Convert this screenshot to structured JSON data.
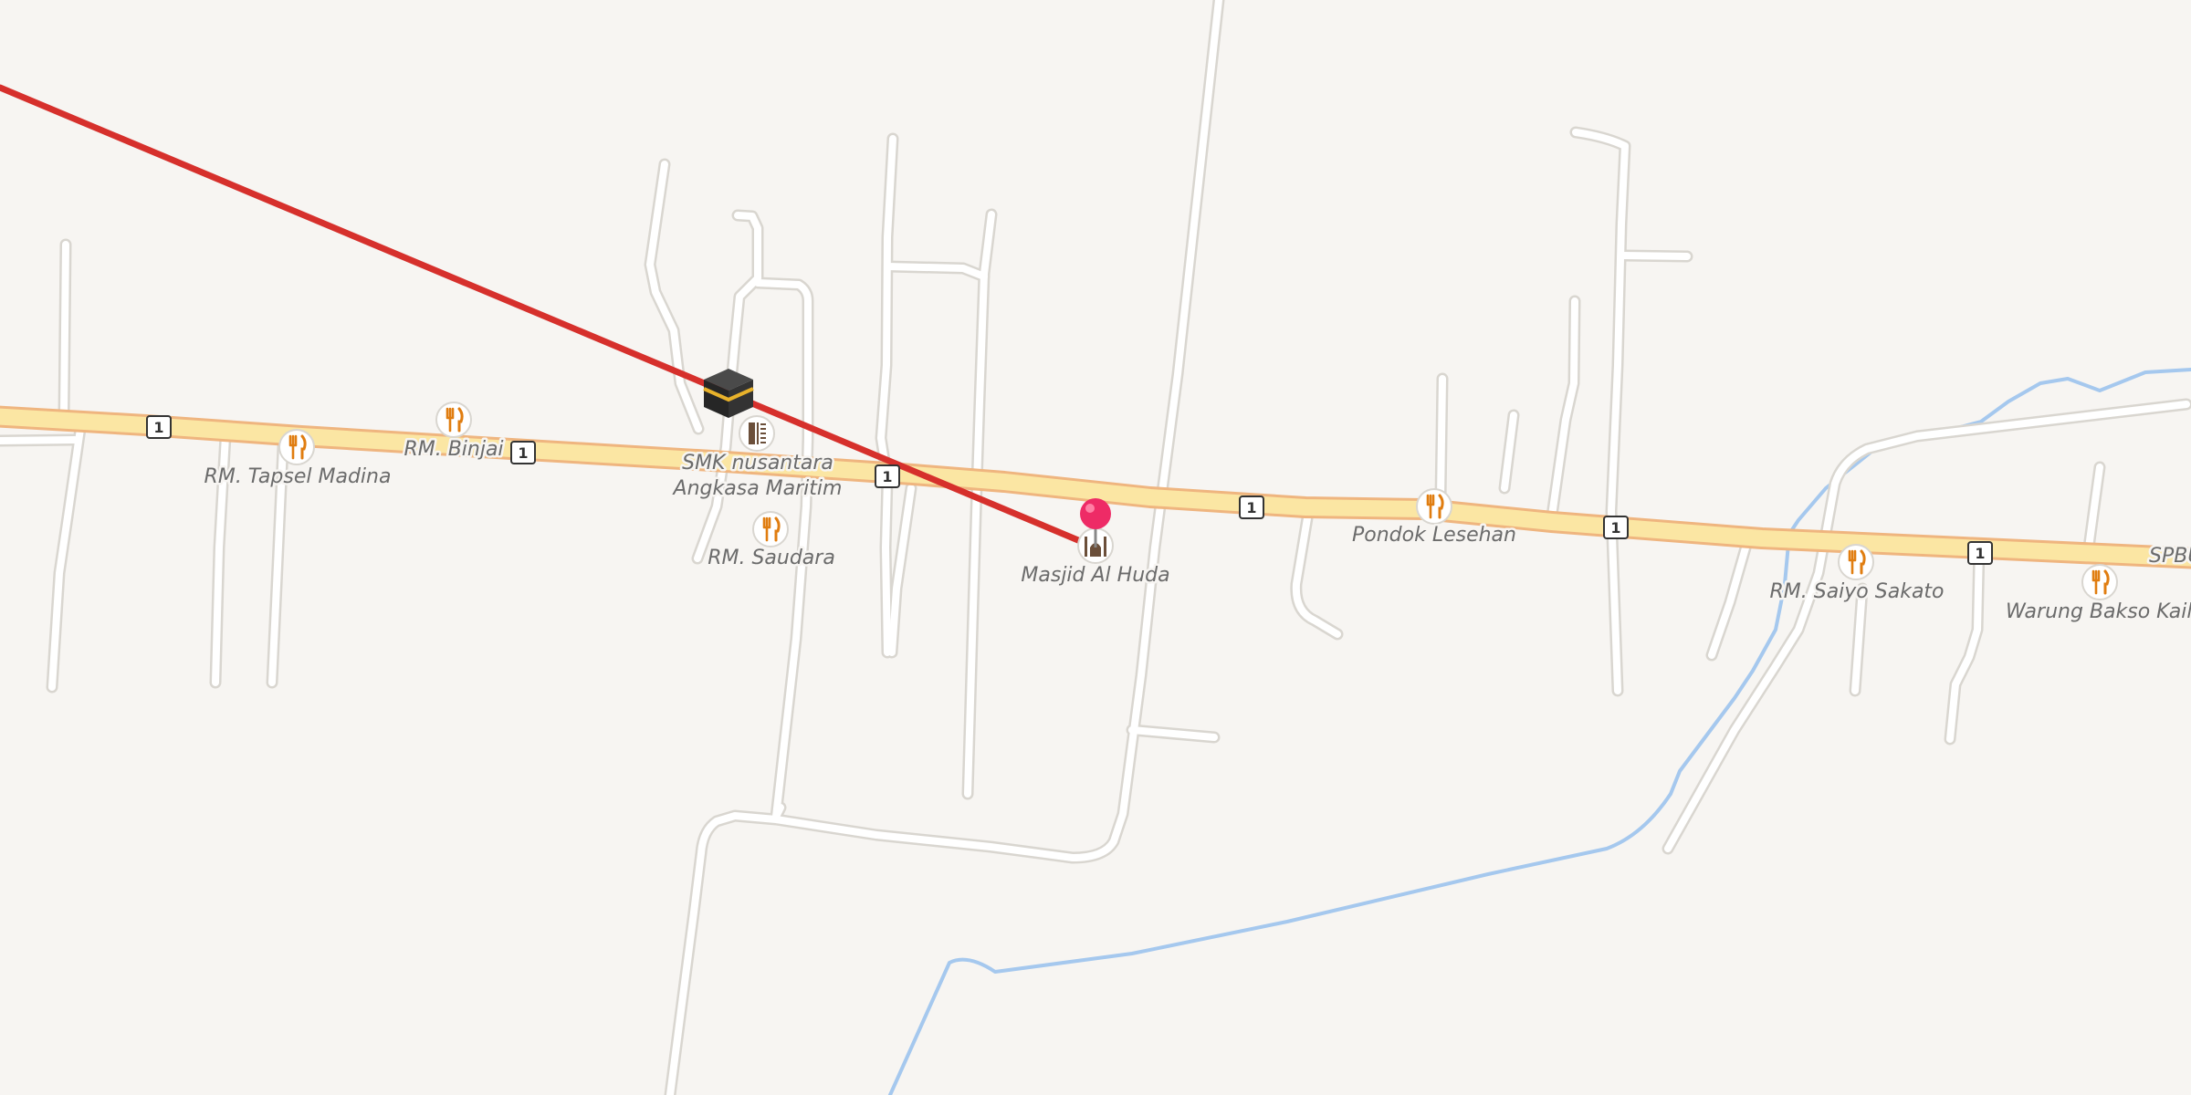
{
  "map": {
    "colors": {
      "background": "#f7f5f2",
      "main_road_fill": "#fbe6a3",
      "main_road_casing": "#efb57f",
      "minor_road_fill": "#ffffff",
      "minor_road_casing": "#d9d6d0",
      "water": "#a5c8ee",
      "route_line": "#d6302c",
      "pin": "#ee2b66"
    },
    "road_shields": [
      "1",
      "1",
      "1",
      "1",
      "1",
      "1"
    ],
    "pois": [
      {
        "name": "RM. Tapsel Madina",
        "icon": "restaurant-icon"
      },
      {
        "name": "RM. Binjai",
        "icon": "restaurant-icon"
      },
      {
        "name": "SMK nusantara",
        "name_line2": "Angkasa Maritim",
        "icon": "school-icon"
      },
      {
        "name": "RM. Saudara",
        "icon": "restaurant-icon"
      },
      {
        "name": "Masjid Al Huda",
        "icon": "mosque-icon"
      },
      {
        "name": "Pondok Lesehan",
        "icon": "restaurant-icon"
      },
      {
        "name": "RM. Saiyo Sakato",
        "icon": "restaurant-icon"
      },
      {
        "name": "Warung Bakso Kaila",
        "icon": "restaurant-icon"
      },
      {
        "name": "SPBU",
        "icon": ""
      }
    ],
    "qibla_marker": {
      "icon": "kaaba-icon"
    },
    "location_pin": {
      "icon": "location-pin-icon"
    },
    "route": {
      "icon": "qibla-direction-line"
    }
  }
}
